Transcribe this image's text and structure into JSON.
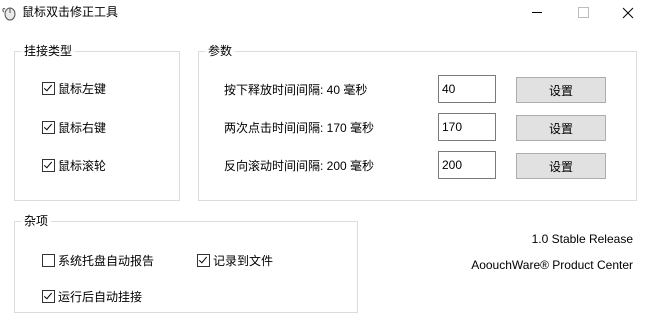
{
  "window": {
    "title": "鼠标双击修正工具",
    "minimize_icon": "minimize-icon",
    "maximize_icon": "maximize-icon",
    "close_icon": "close-icon"
  },
  "mouse_type": {
    "title": "挂接类型",
    "options": [
      {
        "label": "鼠标左键",
        "checked": true
      },
      {
        "label": "鼠标右键",
        "checked": true
      },
      {
        "label": "鼠标滚轮",
        "checked": true
      }
    ]
  },
  "params": {
    "title": "参数",
    "rows": [
      {
        "label": "按下释放时间间隔: 40 毫秒",
        "value": "40",
        "button": "设置"
      },
      {
        "label": "两次点击时间间隔: 170 毫秒",
        "value": "170",
        "button": "设置"
      },
      {
        "label": "反向滚动时间间隔: 200 毫秒",
        "value": "200",
        "button": "设置"
      }
    ]
  },
  "misc": {
    "title": "杂项",
    "options": [
      {
        "label": "系统托盘自动报告",
        "checked": false
      },
      {
        "label": "记录到文件",
        "checked": true
      },
      {
        "label": "运行后自动挂接",
        "checked": true
      }
    ]
  },
  "footer": {
    "version": "1.0 Stable Release",
    "product": "AoouchWare® Product Center"
  }
}
